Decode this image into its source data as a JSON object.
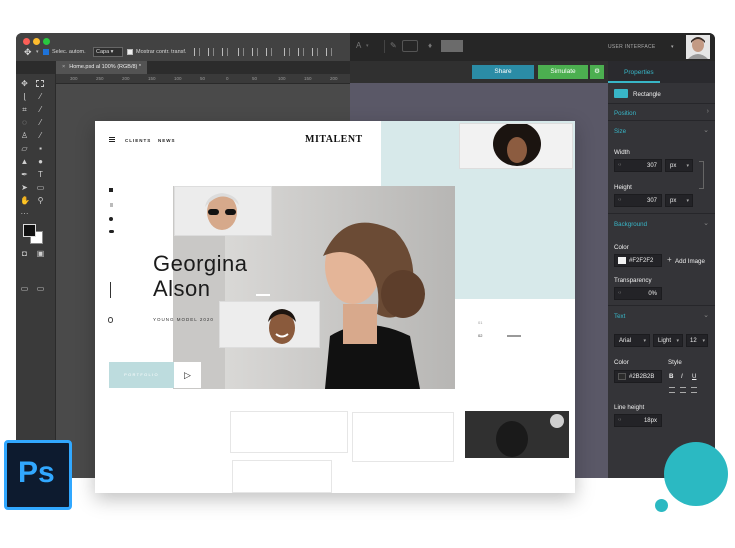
{
  "photoshop": {
    "options": {
      "auto_select": "Selec. autom.",
      "layer_select": "Capa",
      "show_transform": "Mostrar contr. transf."
    },
    "document_tab": "Home.psd al 100% (RGB/8) *",
    "ruler_ticks": [
      "300",
      "250",
      "200",
      "150",
      "100",
      "50",
      "0",
      "50",
      "100",
      "150",
      "200"
    ],
    "logo_text": "Ps"
  },
  "right_app": {
    "top_label": "USER INTERFACE",
    "share_label": "Share",
    "simulate_label": "Simulate",
    "share_color": "#2b8ca6",
    "simulate_color": "#4caf50",
    "accent": "#38b6c7"
  },
  "properties": {
    "tab_label": "Properties",
    "element_type": "Rectangle",
    "position_label": "Position",
    "size_label": "Size",
    "width_label": "Width",
    "width_value": "307",
    "width_unit": "px",
    "height_label": "Height",
    "height_value": "307",
    "height_unit": "px",
    "background_label": "Background",
    "color_label": "Color",
    "bg_color_value": "#F2F2F2",
    "add_image_label": "Add Image",
    "transparency_label": "Transparency",
    "transparency_value": "0%",
    "text_label": "Text",
    "font_family": "Arial",
    "font_weight": "Light",
    "font_size": "12",
    "text_color_label": "Color",
    "style_label": "Style",
    "text_color_value": "#2B2B2B",
    "style_bold": "B",
    "style_italic": "I",
    "style_underline": "U",
    "line_height_label": "Line height",
    "line_height_value": "18",
    "line_height_unit": "px"
  },
  "website": {
    "nav_clients": "CLIENTS",
    "nav_news": "NEWS",
    "brand": "MITALENT",
    "hero_first": "Georgina",
    "hero_last": "Alson",
    "subtitle": "YOUNG MODEL 2020",
    "portfolio_label": "PORTFOLIO",
    "pager_top": "01",
    "pager_bottom": "02"
  }
}
